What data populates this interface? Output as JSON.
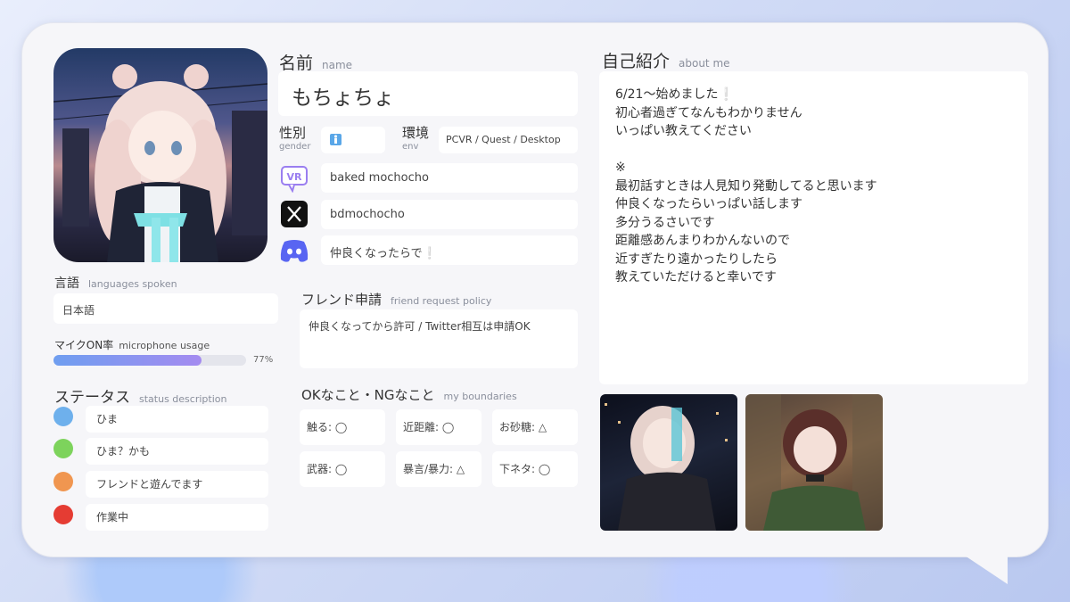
{
  "profile": {
    "name_label": "名前",
    "name_sub": "name",
    "name": "もちょちょ",
    "gender_label": "性別",
    "gender_sub": "gender",
    "env_label": "環境",
    "env_sub": "env",
    "env_value": "PCVR / Quest / Desktop",
    "vrchat_name": "baked mochocho",
    "x_handle": "bdmochocho",
    "discord_text": "仲良くなったらで",
    "discord_mark": "❕"
  },
  "language": {
    "label": "言語",
    "sub": "languages spoken",
    "value": "日本語"
  },
  "mic": {
    "label": "マイクON率",
    "sub": "microphone usage",
    "percent_text": "77%",
    "percent": 77
  },
  "status": {
    "label": "ステータス",
    "sub": "status description",
    "items": [
      {
        "label": "ひま",
        "color": "#6eb0ec"
      },
      {
        "label": "ひま？かも",
        "color": "#7dd35c"
      },
      {
        "label": "フレンドと遊んでます",
        "color": "#f09650"
      },
      {
        "label": "作業中",
        "color": "#e53c33"
      }
    ]
  },
  "friend": {
    "label": "フレンド申請",
    "sub": "friend request policy",
    "value": "仲良くなってから許可 / Twitter相互は申請OK"
  },
  "boundaries": {
    "label": "OKなこと・NGなこと",
    "sub": "my boundaries",
    "items": [
      "触る: ◯",
      "近距離: ◯",
      "お砂糖: △",
      "武器: ◯",
      "暴言/暴力: △",
      "下ネタ: ◯"
    ]
  },
  "about": {
    "label": "自己紹介",
    "sub": "about me",
    "lines": [
      "6/21〜始めました❕",
      "初心者過ぎてなんもわかりません",
      "いっぱい教えてください",
      "",
      "※",
      "最初話すときは人見知り発動してると思います",
      "仲良くなったらいっぱい話します",
      "多分うるさいです",
      "距離感あんまりわかんないので",
      "近すぎたり遠かったりしたら",
      "教えていただけると幸いです"
    ]
  },
  "colors": {
    "accent_bar_start": "#6f9ef0",
    "accent_bar_end": "#a48bf0",
    "card_bg": "#f6f6f9"
  },
  "icons": [
    "vrchat-icon",
    "x-icon",
    "discord-icon",
    "gender-icon"
  ]
}
